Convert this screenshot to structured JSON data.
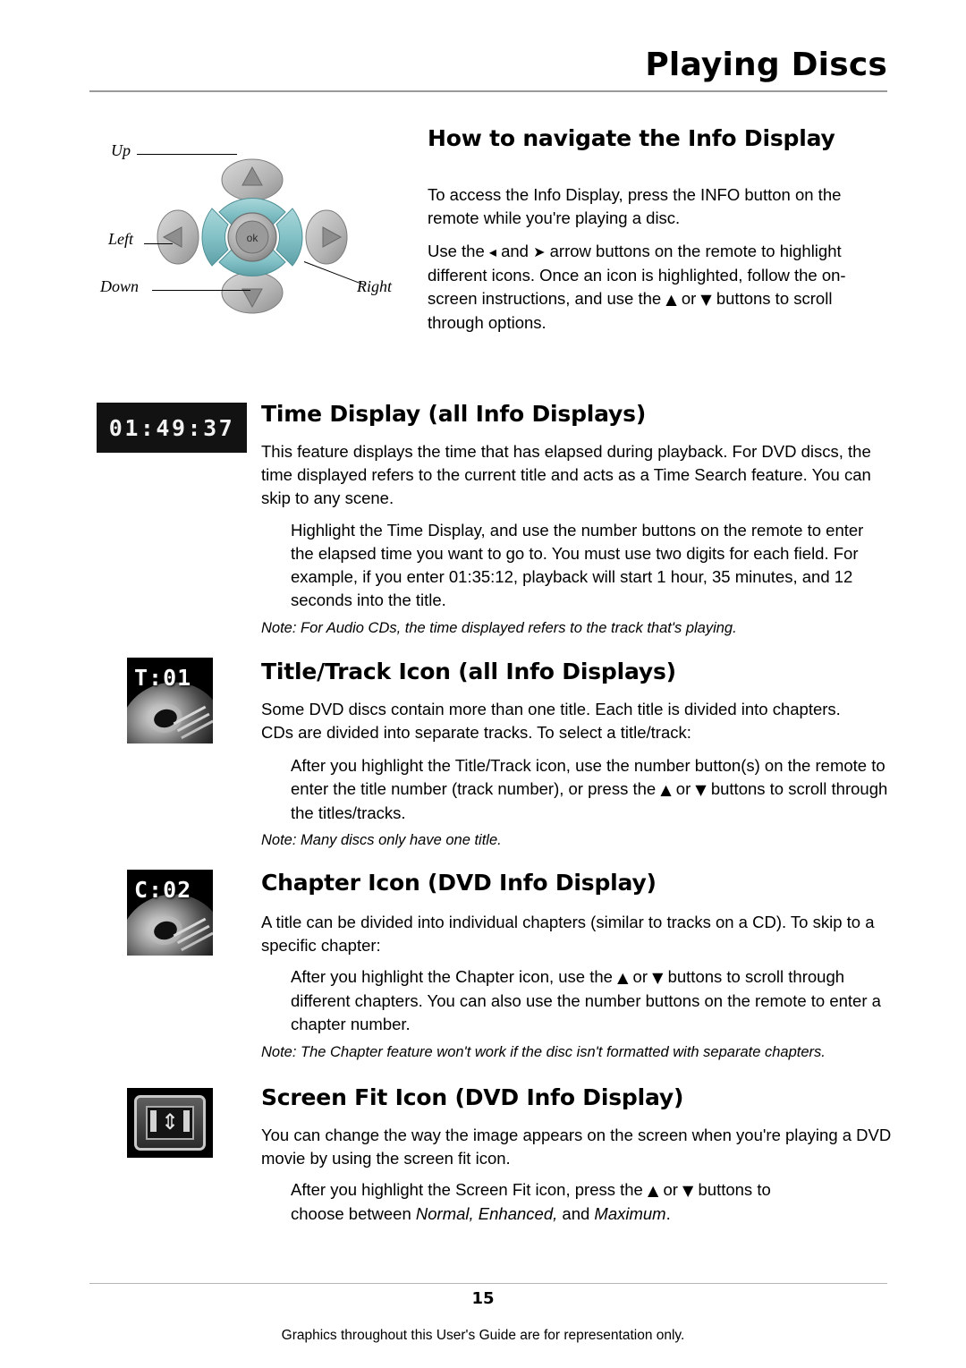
{
  "header": {
    "title": "Playing Discs"
  },
  "sections": {
    "navigate": {
      "heading": "How to navigate the Info Display",
      "paragraph1": "To access the Info Display, press the INFO button on the remote while you're playing a disc.",
      "paragraph2_a": "Use the",
      "paragraph2_b": "and",
      "paragraph2_c": "arrow buttons on the remote to highlight different icons. Once an icon is highlighted, follow the on-screen instructions, and use the",
      "paragraph2_d": "or",
      "paragraph2_e": "buttons to scroll through options."
    },
    "time_display": {
      "heading": "Time Display (all Info Displays)",
      "icon_label": "01:49:37",
      "paragraph1": "This feature displays the time that has elapsed during playback. For DVD discs, the time displayed refers to the current title and acts as a Time Search feature. You can skip to any scene.",
      "indent1": "Highlight the Time Display, and use the number buttons on the remote to enter the elapsed time you want to go to. You must use two digits for each field. For example, if you enter 01:35:12, playback will start 1 hour, 35 minutes, and 12 seconds into the title.",
      "note": "Note: For Audio CDs, the time displayed refers to the track that's playing."
    },
    "title_track": {
      "heading": "Title/Track Icon (all Info Displays)",
      "icon_label": "T:01",
      "paragraph1": "Some DVD discs contain more than one title. Each title is divided into chapters. CDs are divided into separate tracks. To select a title/track:",
      "indent1_a": "After you highlight the Title/Track icon, use the number button(s) on the remote to enter the title number (track number), or press the",
      "indent1_b": "or",
      "indent1_c": "buttons to scroll through the titles/tracks.",
      "note": "Note: Many discs only have one title."
    },
    "chapter": {
      "heading": "Chapter Icon (DVD Info Display)",
      "icon_label": "C:02",
      "paragraph1": "A title can be divided into individual chapters (similar to tracks on a CD). To skip to a specific chapter:",
      "indent1_a": "After you highlight the Chapter icon, use the",
      "indent1_b": "or",
      "indent1_c": "buttons to scroll through different chapters. You can also use the number buttons on the remote to enter a chapter number.",
      "note": "Note: The Chapter feature won't work if the disc isn't formatted with separate chapters."
    },
    "screen_fit": {
      "heading": "Screen Fit Icon (DVD Info Display)",
      "paragraph1": "You can change the way the image appears on the screen when you're playing a DVD movie by using the screen fit icon.",
      "indent1_a": "After you highlight the Screen Fit icon, press the",
      "indent1_b": "or",
      "indent1_c": "buttons to",
      "indent2_a": "choose between",
      "indent2_b": "Normal, Enhanced,",
      "indent2_c": "and",
      "indent2_d": "Maximum",
      "indent2_e": "."
    }
  },
  "navpad": {
    "up": "Up",
    "left": "Left",
    "down": "Down",
    "right": "Right",
    "ok": "ok"
  },
  "footer": {
    "page_number": "15",
    "note": "Graphics throughout this User's Guide are for representation only."
  },
  "colors": {
    "pad_teal": "#7fbfc4",
    "pad_grey": "#b9b9b9",
    "rule": "#9a9a9a",
    "icon_bg": "#121212"
  }
}
